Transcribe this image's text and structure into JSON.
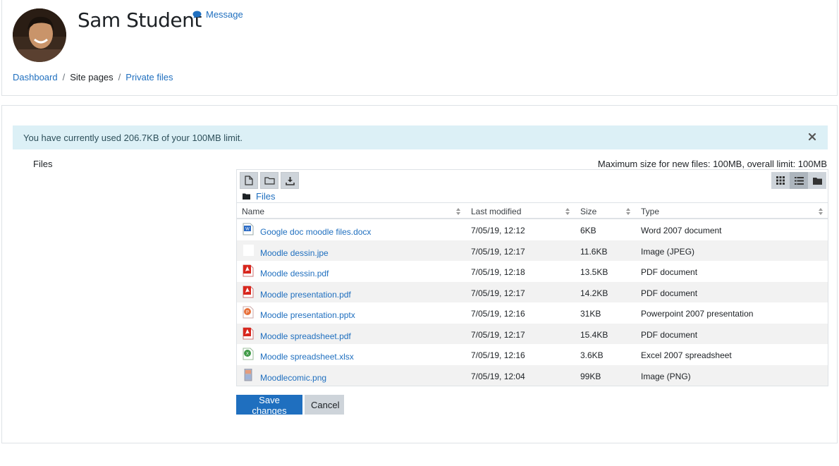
{
  "header": {
    "user_name": "Sam Student",
    "message_label": "Message"
  },
  "breadcrumb": [
    {
      "label": "Dashboard",
      "link": true
    },
    {
      "label": "Site pages",
      "link": false
    },
    {
      "label": "Private files",
      "link": true
    }
  ],
  "alert": {
    "text": "You have currently used 206.7KB of your 100MB limit."
  },
  "form": {
    "files_label": "Files",
    "max_size_text": "Maximum size for new files: 100MB, overall limit: 100MB",
    "save_label": "Save changes",
    "cancel_label": "Cancel"
  },
  "filemanager": {
    "path_label": "Files",
    "columns": {
      "name": "Name",
      "modified": "Last modified",
      "size": "Size",
      "type": "Type"
    },
    "files": [
      {
        "name": "Google doc moodle files.docx",
        "modified": "7/05/19, 12:12",
        "size": "6KB",
        "type": "Word 2007 document",
        "icon": "word-doc-icon"
      },
      {
        "name": "Moodle dessin.jpe",
        "modified": "7/05/19, 12:17",
        "size": "11.6KB",
        "type": "Image (JPEG)",
        "icon": "image-jpeg-icon"
      },
      {
        "name": "Moodle dessin.pdf",
        "modified": "7/05/19, 12:18",
        "size": "13.5KB",
        "type": "PDF document",
        "icon": "pdf-icon"
      },
      {
        "name": "Moodle presentation.pdf",
        "modified": "7/05/19, 12:17",
        "size": "14.2KB",
        "type": "PDF document",
        "icon": "pdf-icon"
      },
      {
        "name": "Moodle presentation.pptx",
        "modified": "7/05/19, 12:16",
        "size": "31KB",
        "type": "Powerpoint 2007 presentation",
        "icon": "powerpoint-icon"
      },
      {
        "name": "Moodle spreadsheet.pdf",
        "modified": "7/05/19, 12:17",
        "size": "15.4KB",
        "type": "PDF document",
        "icon": "pdf-icon"
      },
      {
        "name": "Moodle spreadsheet.xlsx",
        "modified": "7/05/19, 12:16",
        "size": "3.6KB",
        "type": "Excel 2007 spreadsheet",
        "icon": "excel-icon"
      },
      {
        "name": "Moodlecomic.png",
        "modified": "7/05/19, 12:04",
        "size": "99KB",
        "type": "Image (PNG)",
        "icon": "image-png-icon"
      }
    ]
  },
  "colors": {
    "link": "#1f6fbf",
    "primary_button": "#1f6fbf",
    "alert_bg": "#dcf0f6"
  }
}
